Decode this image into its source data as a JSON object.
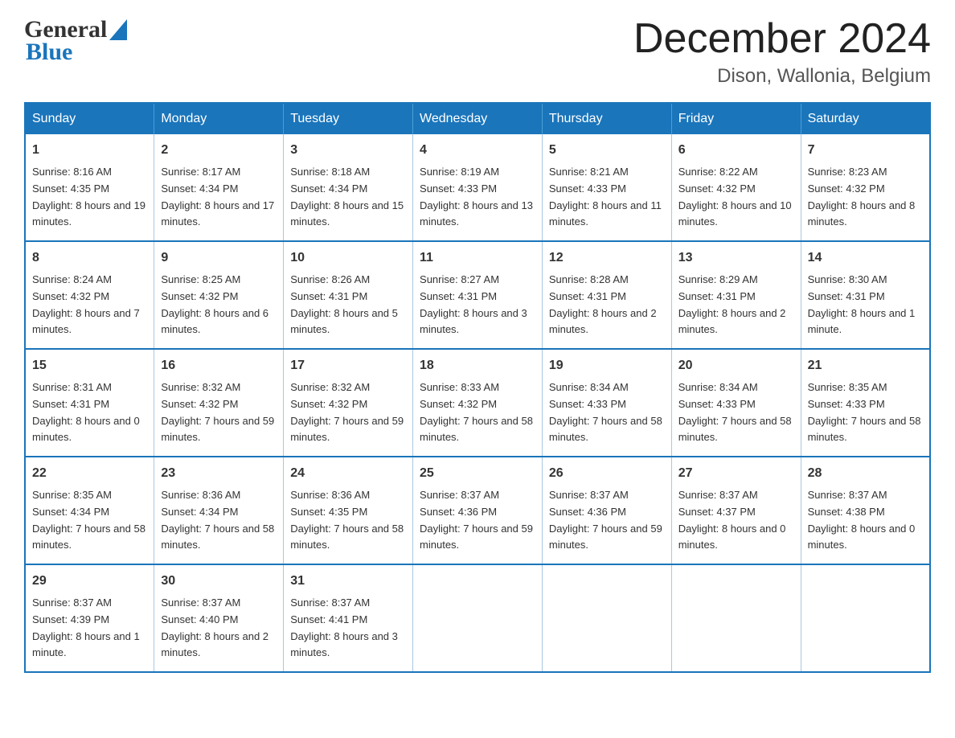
{
  "header": {
    "logo_general": "General",
    "logo_blue": "Blue",
    "month_title": "December 2024",
    "location": "Dison, Wallonia, Belgium"
  },
  "weekdays": [
    "Sunday",
    "Monday",
    "Tuesday",
    "Wednesday",
    "Thursday",
    "Friday",
    "Saturday"
  ],
  "weeks": [
    [
      {
        "day": "1",
        "sunrise": "Sunrise: 8:16 AM",
        "sunset": "Sunset: 4:35 PM",
        "daylight": "Daylight: 8 hours and 19 minutes."
      },
      {
        "day": "2",
        "sunrise": "Sunrise: 8:17 AM",
        "sunset": "Sunset: 4:34 PM",
        "daylight": "Daylight: 8 hours and 17 minutes."
      },
      {
        "day": "3",
        "sunrise": "Sunrise: 8:18 AM",
        "sunset": "Sunset: 4:34 PM",
        "daylight": "Daylight: 8 hours and 15 minutes."
      },
      {
        "day": "4",
        "sunrise": "Sunrise: 8:19 AM",
        "sunset": "Sunset: 4:33 PM",
        "daylight": "Daylight: 8 hours and 13 minutes."
      },
      {
        "day": "5",
        "sunrise": "Sunrise: 8:21 AM",
        "sunset": "Sunset: 4:33 PM",
        "daylight": "Daylight: 8 hours and 11 minutes."
      },
      {
        "day": "6",
        "sunrise": "Sunrise: 8:22 AM",
        "sunset": "Sunset: 4:32 PM",
        "daylight": "Daylight: 8 hours and 10 minutes."
      },
      {
        "day": "7",
        "sunrise": "Sunrise: 8:23 AM",
        "sunset": "Sunset: 4:32 PM",
        "daylight": "Daylight: 8 hours and 8 minutes."
      }
    ],
    [
      {
        "day": "8",
        "sunrise": "Sunrise: 8:24 AM",
        "sunset": "Sunset: 4:32 PM",
        "daylight": "Daylight: 8 hours and 7 minutes."
      },
      {
        "day": "9",
        "sunrise": "Sunrise: 8:25 AM",
        "sunset": "Sunset: 4:32 PM",
        "daylight": "Daylight: 8 hours and 6 minutes."
      },
      {
        "day": "10",
        "sunrise": "Sunrise: 8:26 AM",
        "sunset": "Sunset: 4:31 PM",
        "daylight": "Daylight: 8 hours and 5 minutes."
      },
      {
        "day": "11",
        "sunrise": "Sunrise: 8:27 AM",
        "sunset": "Sunset: 4:31 PM",
        "daylight": "Daylight: 8 hours and 3 minutes."
      },
      {
        "day": "12",
        "sunrise": "Sunrise: 8:28 AM",
        "sunset": "Sunset: 4:31 PM",
        "daylight": "Daylight: 8 hours and 2 minutes."
      },
      {
        "day": "13",
        "sunrise": "Sunrise: 8:29 AM",
        "sunset": "Sunset: 4:31 PM",
        "daylight": "Daylight: 8 hours and 2 minutes."
      },
      {
        "day": "14",
        "sunrise": "Sunrise: 8:30 AM",
        "sunset": "Sunset: 4:31 PM",
        "daylight": "Daylight: 8 hours and 1 minute."
      }
    ],
    [
      {
        "day": "15",
        "sunrise": "Sunrise: 8:31 AM",
        "sunset": "Sunset: 4:31 PM",
        "daylight": "Daylight: 8 hours and 0 minutes."
      },
      {
        "day": "16",
        "sunrise": "Sunrise: 8:32 AM",
        "sunset": "Sunset: 4:32 PM",
        "daylight": "Daylight: 7 hours and 59 minutes."
      },
      {
        "day": "17",
        "sunrise": "Sunrise: 8:32 AM",
        "sunset": "Sunset: 4:32 PM",
        "daylight": "Daylight: 7 hours and 59 minutes."
      },
      {
        "day": "18",
        "sunrise": "Sunrise: 8:33 AM",
        "sunset": "Sunset: 4:32 PM",
        "daylight": "Daylight: 7 hours and 58 minutes."
      },
      {
        "day": "19",
        "sunrise": "Sunrise: 8:34 AM",
        "sunset": "Sunset: 4:33 PM",
        "daylight": "Daylight: 7 hours and 58 minutes."
      },
      {
        "day": "20",
        "sunrise": "Sunrise: 8:34 AM",
        "sunset": "Sunset: 4:33 PM",
        "daylight": "Daylight: 7 hours and 58 minutes."
      },
      {
        "day": "21",
        "sunrise": "Sunrise: 8:35 AM",
        "sunset": "Sunset: 4:33 PM",
        "daylight": "Daylight: 7 hours and 58 minutes."
      }
    ],
    [
      {
        "day": "22",
        "sunrise": "Sunrise: 8:35 AM",
        "sunset": "Sunset: 4:34 PM",
        "daylight": "Daylight: 7 hours and 58 minutes."
      },
      {
        "day": "23",
        "sunrise": "Sunrise: 8:36 AM",
        "sunset": "Sunset: 4:34 PM",
        "daylight": "Daylight: 7 hours and 58 minutes."
      },
      {
        "day": "24",
        "sunrise": "Sunrise: 8:36 AM",
        "sunset": "Sunset: 4:35 PM",
        "daylight": "Daylight: 7 hours and 58 minutes."
      },
      {
        "day": "25",
        "sunrise": "Sunrise: 8:37 AM",
        "sunset": "Sunset: 4:36 PM",
        "daylight": "Daylight: 7 hours and 59 minutes."
      },
      {
        "day": "26",
        "sunrise": "Sunrise: 8:37 AM",
        "sunset": "Sunset: 4:36 PM",
        "daylight": "Daylight: 7 hours and 59 minutes."
      },
      {
        "day": "27",
        "sunrise": "Sunrise: 8:37 AM",
        "sunset": "Sunset: 4:37 PM",
        "daylight": "Daylight: 8 hours and 0 minutes."
      },
      {
        "day": "28",
        "sunrise": "Sunrise: 8:37 AM",
        "sunset": "Sunset: 4:38 PM",
        "daylight": "Daylight: 8 hours and 0 minutes."
      }
    ],
    [
      {
        "day": "29",
        "sunrise": "Sunrise: 8:37 AM",
        "sunset": "Sunset: 4:39 PM",
        "daylight": "Daylight: 8 hours and 1 minute."
      },
      {
        "day": "30",
        "sunrise": "Sunrise: 8:37 AM",
        "sunset": "Sunset: 4:40 PM",
        "daylight": "Daylight: 8 hours and 2 minutes."
      },
      {
        "day": "31",
        "sunrise": "Sunrise: 8:37 AM",
        "sunset": "Sunset: 4:41 PM",
        "daylight": "Daylight: 8 hours and 3 minutes."
      },
      null,
      null,
      null,
      null
    ]
  ]
}
